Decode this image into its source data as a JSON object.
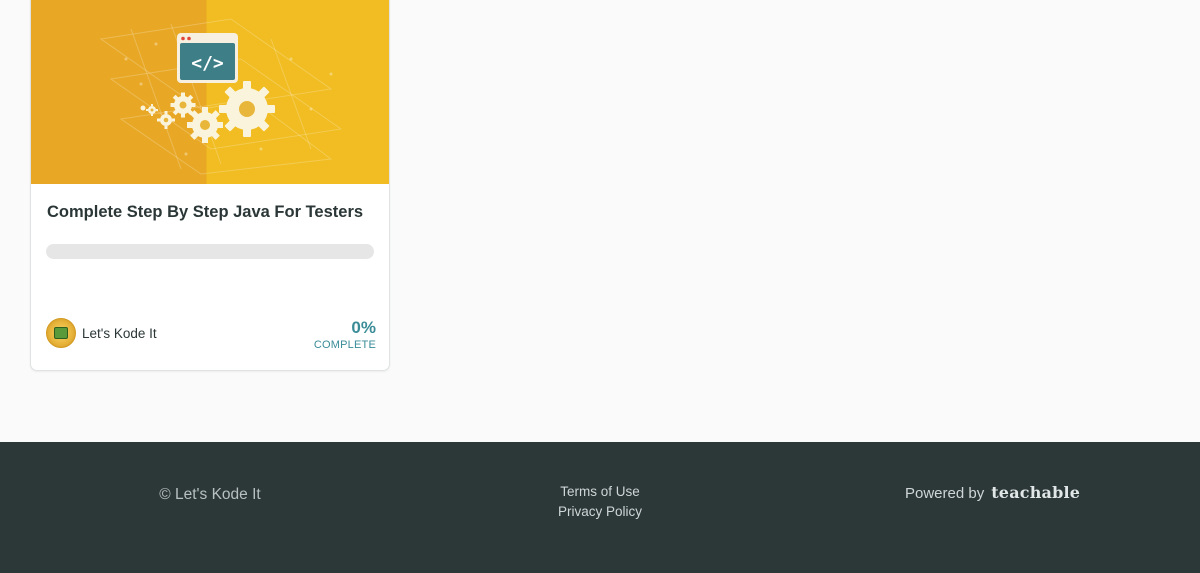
{
  "course": {
    "title": "Complete Step By Step Java For Testers",
    "author": "Let's Kode It",
    "progress_percent": 0,
    "percent_text": "0%",
    "complete_label": "COMPLETE",
    "image_icon": "code-window-with-gears-icon"
  },
  "footer": {
    "copyright": "© Let's Kode It",
    "links": [
      "Terms of Use",
      "Privacy Policy"
    ],
    "powered_by": "Powered by",
    "brand": "teachable"
  },
  "colors": {
    "accent": "#3a8c97",
    "footer_bg": "#2c3738",
    "card_image_left": "#e8a826",
    "card_image_right": "#f1bd22"
  }
}
